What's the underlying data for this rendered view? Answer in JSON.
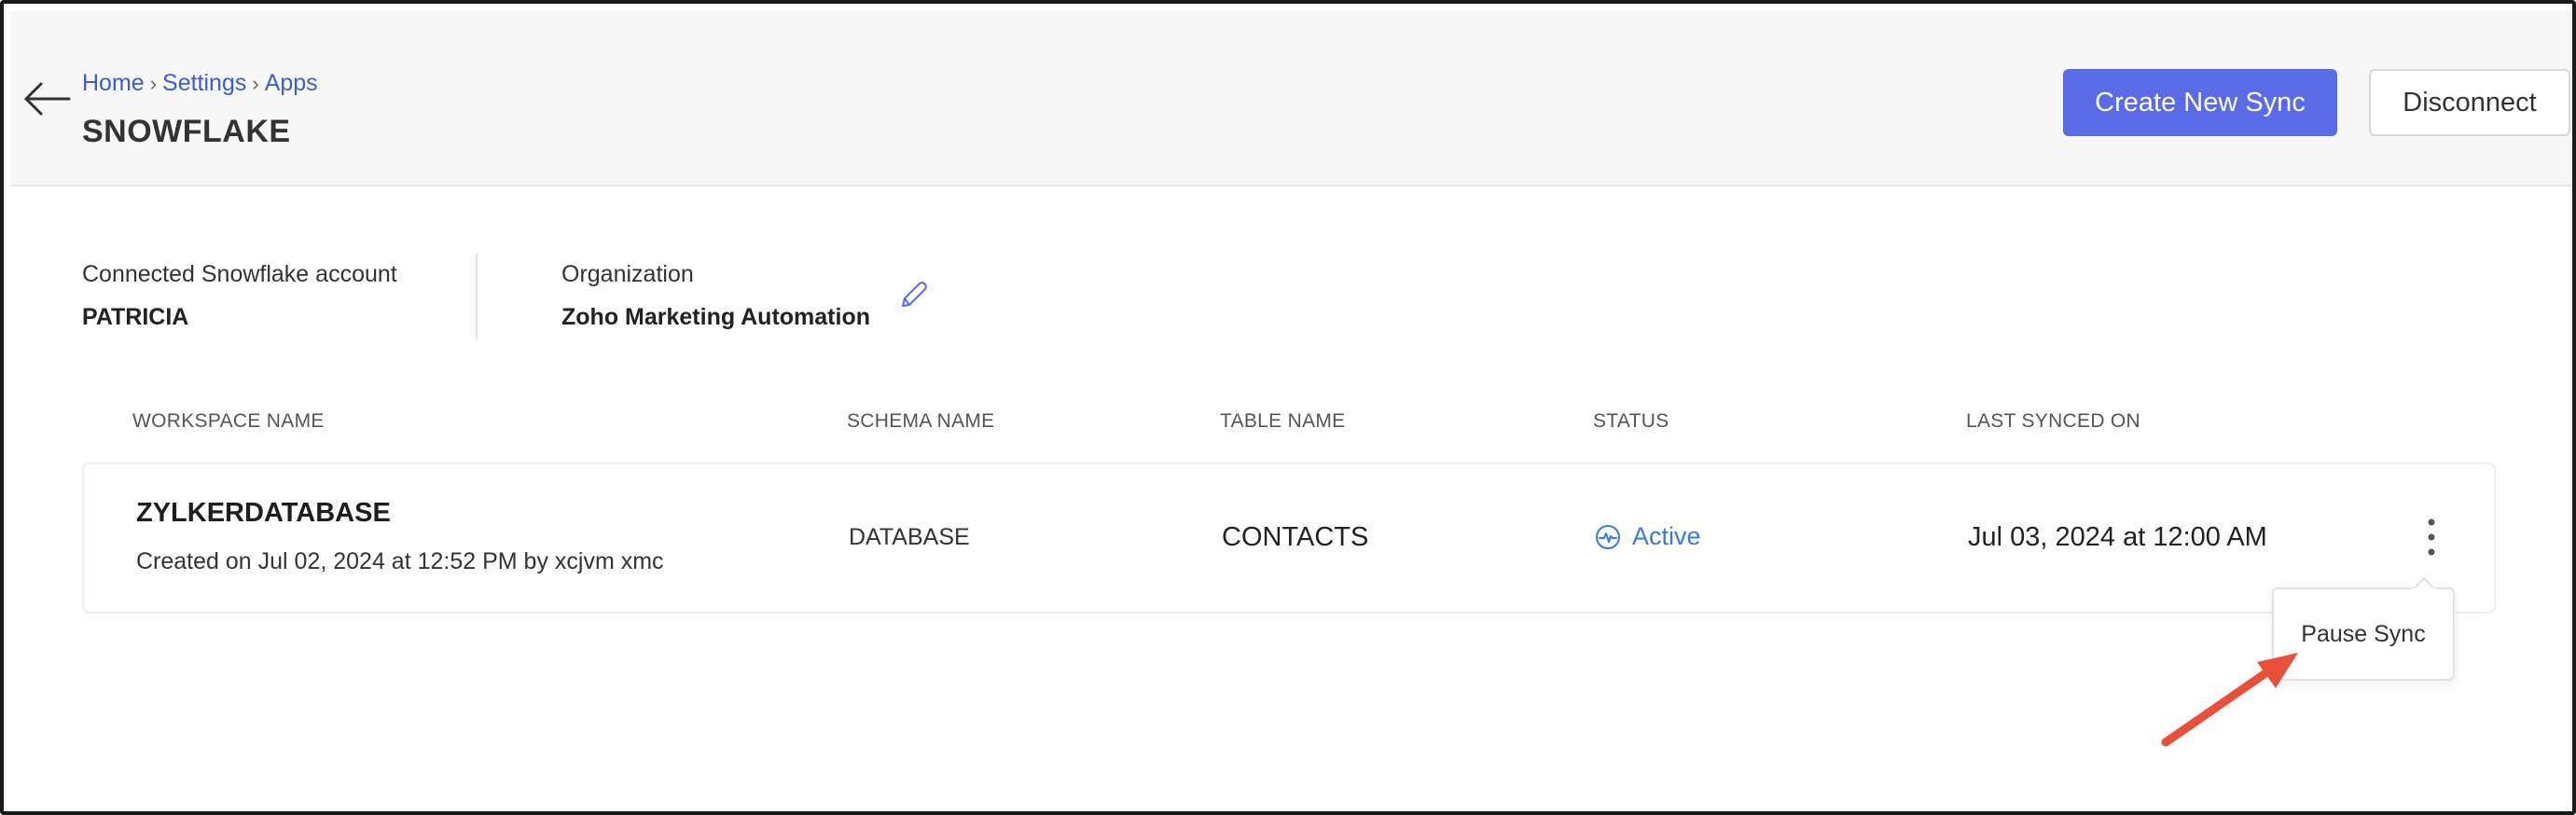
{
  "header": {
    "breadcrumb": [
      {
        "label": "Home"
      },
      {
        "label": "Settings"
      },
      {
        "label": "Apps"
      }
    ],
    "breadcrumb_separator": "›",
    "title": "SNOWFLAKE",
    "create_button_label": "Create New Sync",
    "disconnect_button_label": "Disconnect"
  },
  "account": {
    "connected_label": "Connected Snowflake account",
    "connected_value": "PATRICIA",
    "organization_label": "Organization",
    "organization_value": "Zoho Marketing Automation"
  },
  "table": {
    "columns": [
      "WORKSPACE NAME",
      "SCHEMA NAME",
      "TABLE NAME",
      "STATUS",
      "LAST SYNCED ON"
    ],
    "rows": [
      {
        "workspace_name": "ZYLKERDATABASE",
        "created": "Created on Jul 02, 2024 at 12:52 PM by xcjvm xmc",
        "schema_name": "DATABASE",
        "table_name": "CONTACTS",
        "status": "Active",
        "last_synced": "Jul 03, 2024 at 12:00 AM"
      }
    ]
  },
  "row_menu": {
    "items": [
      {
        "label": "Pause Sync"
      }
    ]
  },
  "icons": {
    "back": "arrow-left-icon",
    "edit": "pencil-icon",
    "status": "activity-pulse-icon",
    "more": "vertical-dots-icon"
  },
  "colors": {
    "primary": "#5a6be8",
    "link": "#3d5fc4",
    "status_active": "#3a7bd5",
    "annotation": "#e8503a",
    "header_bg": "#f7f7f7"
  }
}
